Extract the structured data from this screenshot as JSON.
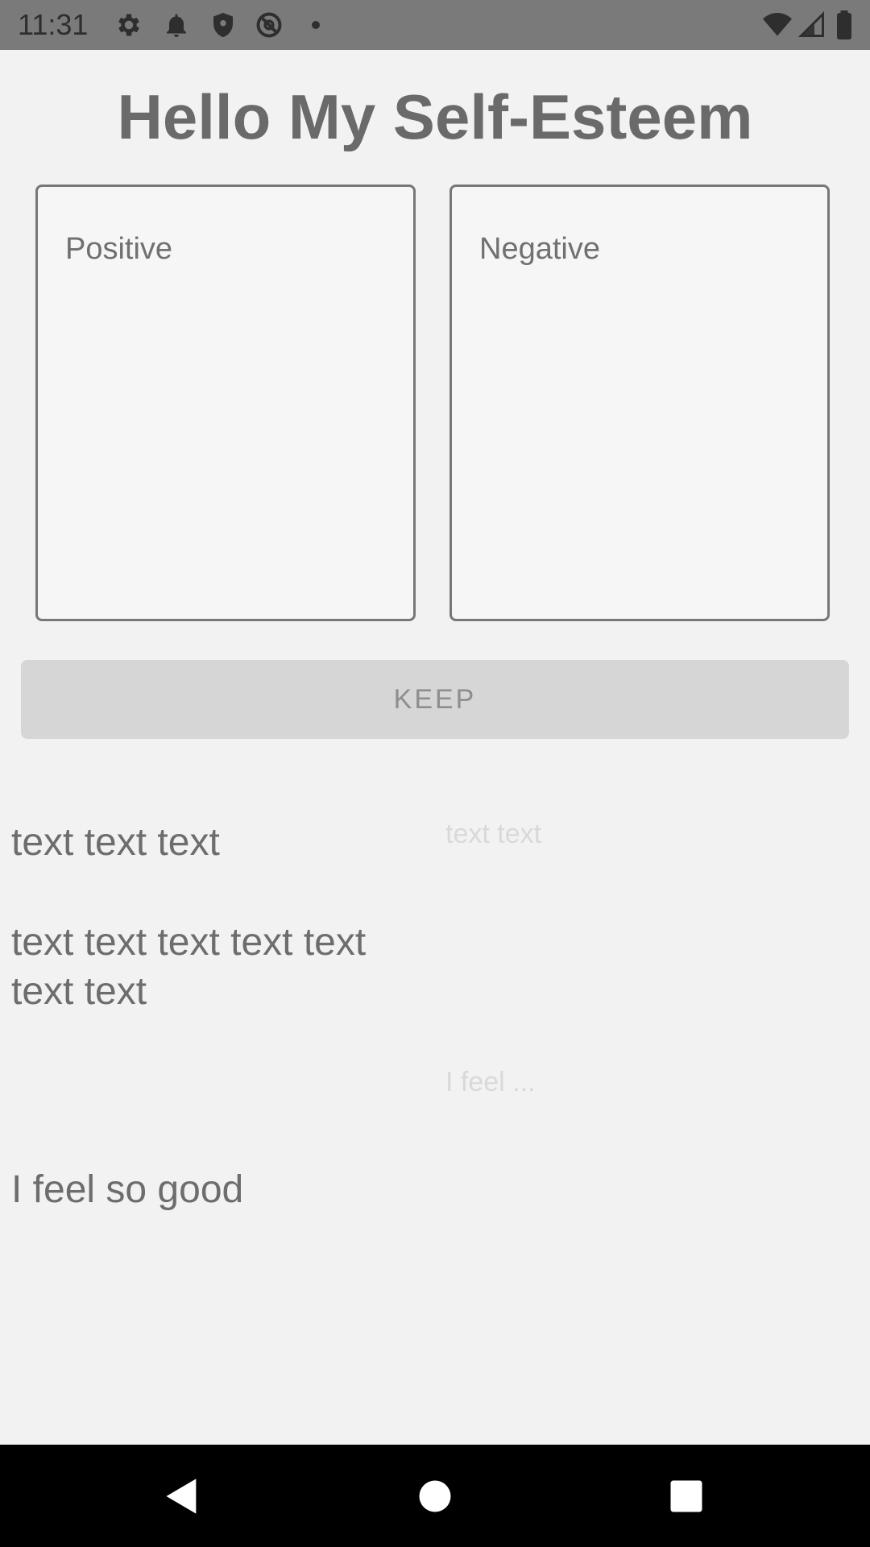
{
  "status_bar": {
    "time": "11:31",
    "icons_left": [
      "gear-icon",
      "bell-icon",
      "shield-icon",
      "at-icon",
      "dot-icon"
    ],
    "icons_right": [
      "wifi-icon",
      "signal-icon",
      "battery-icon"
    ]
  },
  "header": {
    "title": "Hello My Self-Esteem"
  },
  "inputs": {
    "positive_placeholder": "Positive",
    "negative_placeholder": "Negative"
  },
  "actions": {
    "keep_label": "KEEP"
  },
  "entries": {
    "left": [
      "text text text",
      "text text text text text text text",
      "I feel so good"
    ],
    "right_hints": [
      "text text",
      "I feel ..."
    ]
  },
  "colors": {
    "status_bar": "#7a7a7a",
    "background": "#f2f2f2",
    "button": "#d6d6d6",
    "nav_bar": "#000000"
  }
}
